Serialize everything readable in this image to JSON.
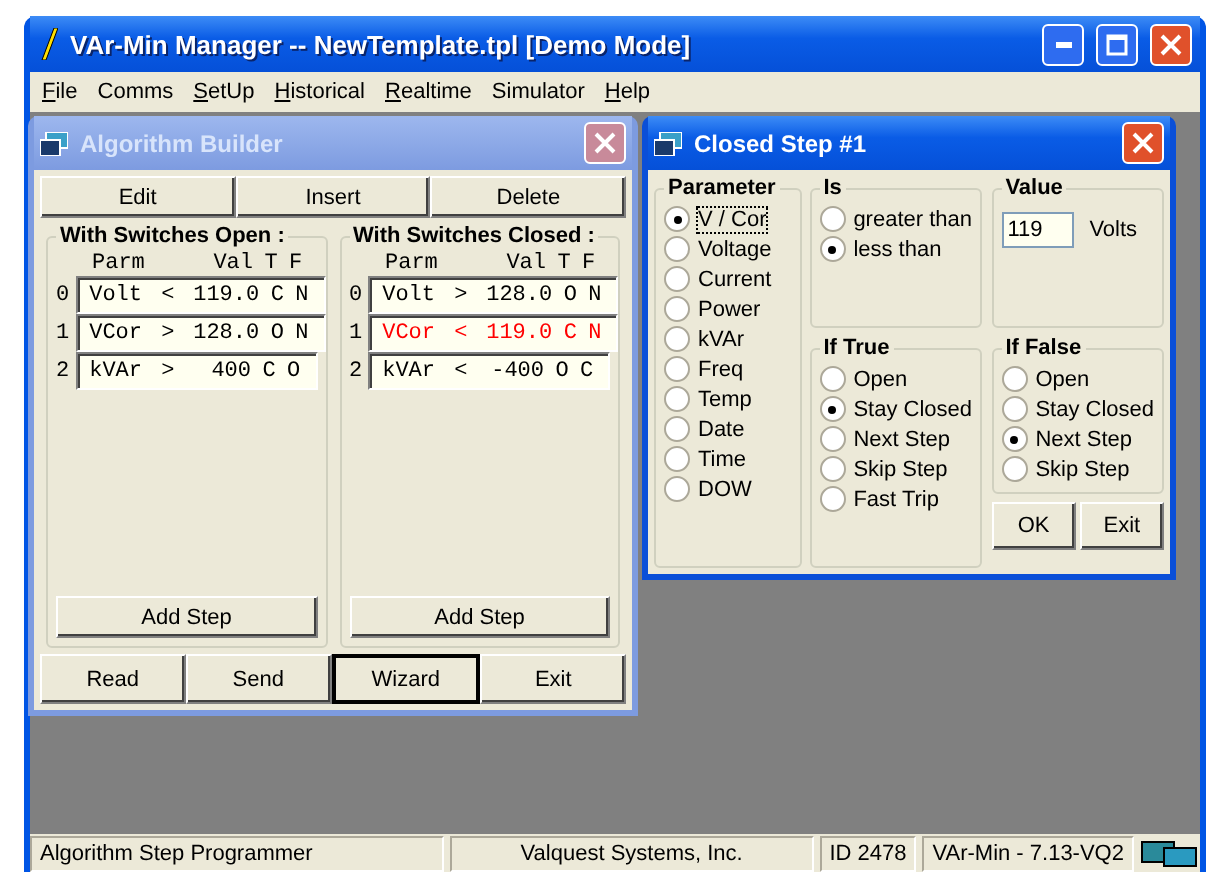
{
  "window": {
    "title": "VAr-Min Manager  --  NewTemplate.tpl  [Demo Mode]"
  },
  "menu": [
    {
      "label": "File",
      "mnemonic": true
    },
    {
      "label": "Comms",
      "mnemonic": false
    },
    {
      "label": "SetUp",
      "mnemonic": true
    },
    {
      "label": "Historical",
      "mnemonic": true
    },
    {
      "label": "Realtime",
      "mnemonic": true
    },
    {
      "label": "Simulator",
      "mnemonic": false
    },
    {
      "label": "Help",
      "mnemonic": true
    }
  ],
  "algorithm_builder": {
    "title": "Algorithm Builder",
    "toolbar": [
      {
        "label": "Edit",
        "default": false
      },
      {
        "label": "Insert",
        "default": false
      },
      {
        "label": "Delete",
        "default": false
      }
    ],
    "groups": [
      {
        "title": "With Switches Open :",
        "columns": [
          "Parm",
          "Val",
          "T",
          "F"
        ],
        "rows": [
          {
            "index": "0",
            "parm": "Volt",
            "op": "<",
            "val": "119.0",
            "t": "C",
            "f": "N",
            "highlighted": false
          },
          {
            "index": "1",
            "parm": "VCor",
            "op": ">",
            "val": "128.0",
            "t": "O",
            "f": "N",
            "highlighted": false
          },
          {
            "index": "2",
            "parm": "kVAr",
            "op": ">",
            "val": "400",
            "t": "C",
            "f": "O",
            "highlighted": false
          }
        ],
        "button": "Add Step"
      },
      {
        "title": "With Switches Closed :",
        "columns": [
          "Parm",
          "Val",
          "T",
          "F"
        ],
        "rows": [
          {
            "index": "0",
            "parm": "Volt",
            "op": ">",
            "val": "128.0",
            "t": "O",
            "f": "N",
            "highlighted": false
          },
          {
            "index": "1",
            "parm": "VCor",
            "op": "<",
            "val": "119.0",
            "t": "C",
            "f": "N",
            "highlighted": true
          },
          {
            "index": "2",
            "parm": "kVAr",
            "op": "<",
            "val": "-400",
            "t": "O",
            "f": "C",
            "highlighted": false
          }
        ],
        "button": "Add Step"
      }
    ],
    "buttons": [
      {
        "label": "Read",
        "default": false
      },
      {
        "label": "Send",
        "default": false
      },
      {
        "label": "Wizard",
        "default": true
      },
      {
        "label": "Exit",
        "default": false
      }
    ]
  },
  "closed_step": {
    "title": "Closed Step #1",
    "parameter": {
      "title": "Parameter",
      "options": [
        {
          "label": "V / Cor",
          "selected": true,
          "focused": true
        },
        {
          "label": "Voltage",
          "selected": false,
          "focused": false
        },
        {
          "label": "Current",
          "selected": false,
          "focused": false
        },
        {
          "label": "Power",
          "selected": false,
          "focused": false
        },
        {
          "label": "kVAr",
          "selected": false,
          "focused": false
        },
        {
          "label": "Freq",
          "selected": false,
          "focused": false
        },
        {
          "label": "Temp",
          "selected": false,
          "focused": false
        },
        {
          "label": "Date",
          "selected": false,
          "focused": false
        },
        {
          "label": "Time",
          "selected": false,
          "focused": false
        },
        {
          "label": "DOW",
          "selected": false,
          "focused": false
        }
      ]
    },
    "is": {
      "title": "Is",
      "options": [
        {
          "label": "greater than",
          "selected": false,
          "focused": false
        },
        {
          "label": "less than",
          "selected": true,
          "focused": false
        }
      ]
    },
    "value": {
      "title": "Value",
      "value": "119",
      "unit": "Volts"
    },
    "if_true": {
      "title": "If True",
      "options": [
        {
          "label": "Open",
          "selected": false,
          "focused": false
        },
        {
          "label": "Stay Closed",
          "selected": true,
          "focused": false
        },
        {
          "label": "Next Step",
          "selected": false,
          "focused": false
        },
        {
          "label": "Skip Step",
          "selected": false,
          "focused": false
        },
        {
          "label": "Fast Trip",
          "selected": false,
          "focused": false
        }
      ]
    },
    "if_false": {
      "title": "If False",
      "options": [
        {
          "label": "Open",
          "selected": false,
          "focused": false
        },
        {
          "label": "Stay Closed",
          "selected": false,
          "focused": false
        },
        {
          "label": "Next Step",
          "selected": true,
          "focused": false
        },
        {
          "label": "Skip Step",
          "selected": false,
          "focused": false
        }
      ]
    },
    "buttons": [
      {
        "label": "OK",
        "default": false
      },
      {
        "label": "Exit",
        "default": false
      }
    ]
  },
  "status_bar": [
    "Algorithm Step Programmer",
    "Valquest Systems, Inc.",
    "ID 2478",
    "VAr-Min - 7.13-VQ2"
  ]
}
